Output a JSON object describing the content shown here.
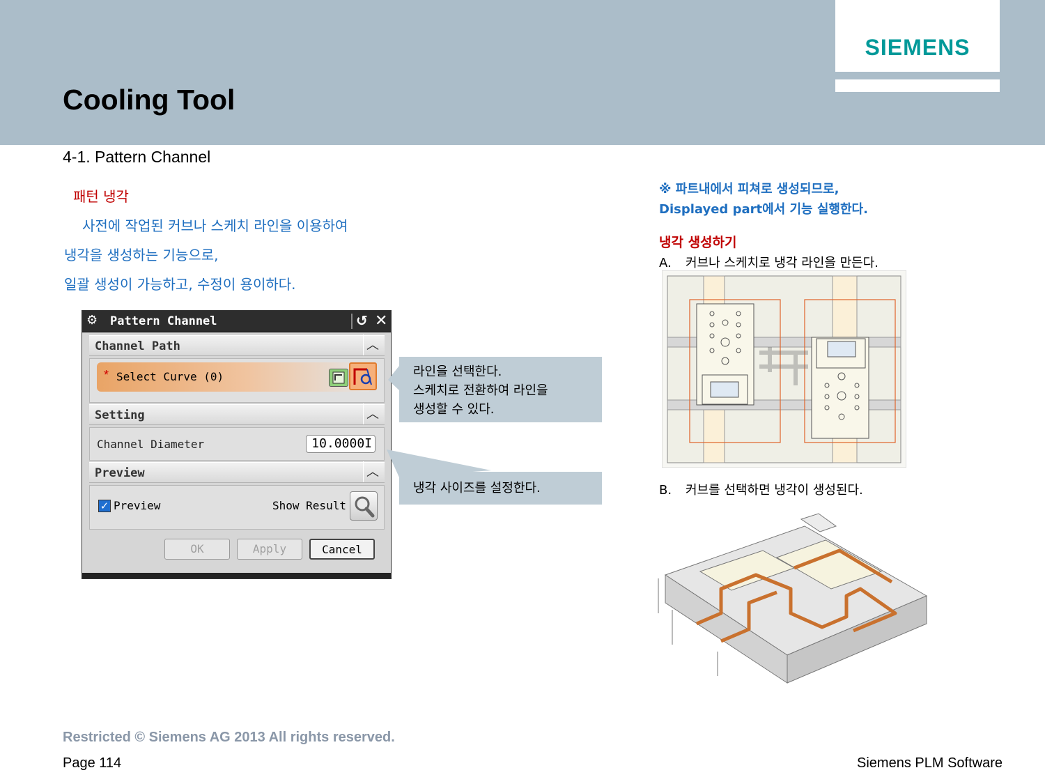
{
  "header": {
    "title": "Cooling Tool",
    "logo": "SIEMENS"
  },
  "section": "4-1. Pattern Channel",
  "left_text": {
    "title": "패턴 냉각",
    "lines": [
      "사전에 작업된 커브나 스케치 라인을 이용하여",
      "냉각을 생성하는 기능으로,",
      "일괄 생성이 가능하고, 수정이 용이하다."
    ]
  },
  "dialog": {
    "title": "Pattern Channel",
    "channel_path": {
      "header": "Channel Path",
      "select_label": "Select Curve (0)",
      "required_mark": "*"
    },
    "setting": {
      "header": "Setting",
      "diameter_label": "Channel Diameter",
      "diameter_value": "10.0000I"
    },
    "preview": {
      "header": "Preview",
      "checkbox_label": "Preview",
      "checked": true,
      "show_result_label": "Show Result"
    },
    "buttons": {
      "ok": "OK",
      "apply": "Apply",
      "cancel": "Cancel"
    }
  },
  "callouts": {
    "select": [
      "라인을 선택한다.",
      "스케치로 전환하여 라인을",
      "생성할 수 있다."
    ],
    "diameter": "냉각 사이즈를 설정한다."
  },
  "right_text": {
    "note1": "※ 파트내에서 피쳐로 생성되므로,",
    "note2": "Displayed part에서 기능 실행한다.",
    "title": "냉각 생성하기",
    "step_a_label": "A.",
    "step_a_text": "커브나 스케치로 냉각 라인을 만든다.",
    "step_b_label": "B.",
    "step_b_text": "커브를 선택하면 냉각이 생성된다."
  },
  "footer": {
    "restricted": "Restricted © Siemens AG 2013 All rights reserved.",
    "page": "Page 114",
    "company": "Siemens PLM Software"
  },
  "colors": {
    "header_bg": "#abbdc9",
    "brand": "#009999",
    "red_text": "#c00000",
    "blue_text": "#1f6fc0",
    "callout_bg": "#bfcdd6"
  }
}
